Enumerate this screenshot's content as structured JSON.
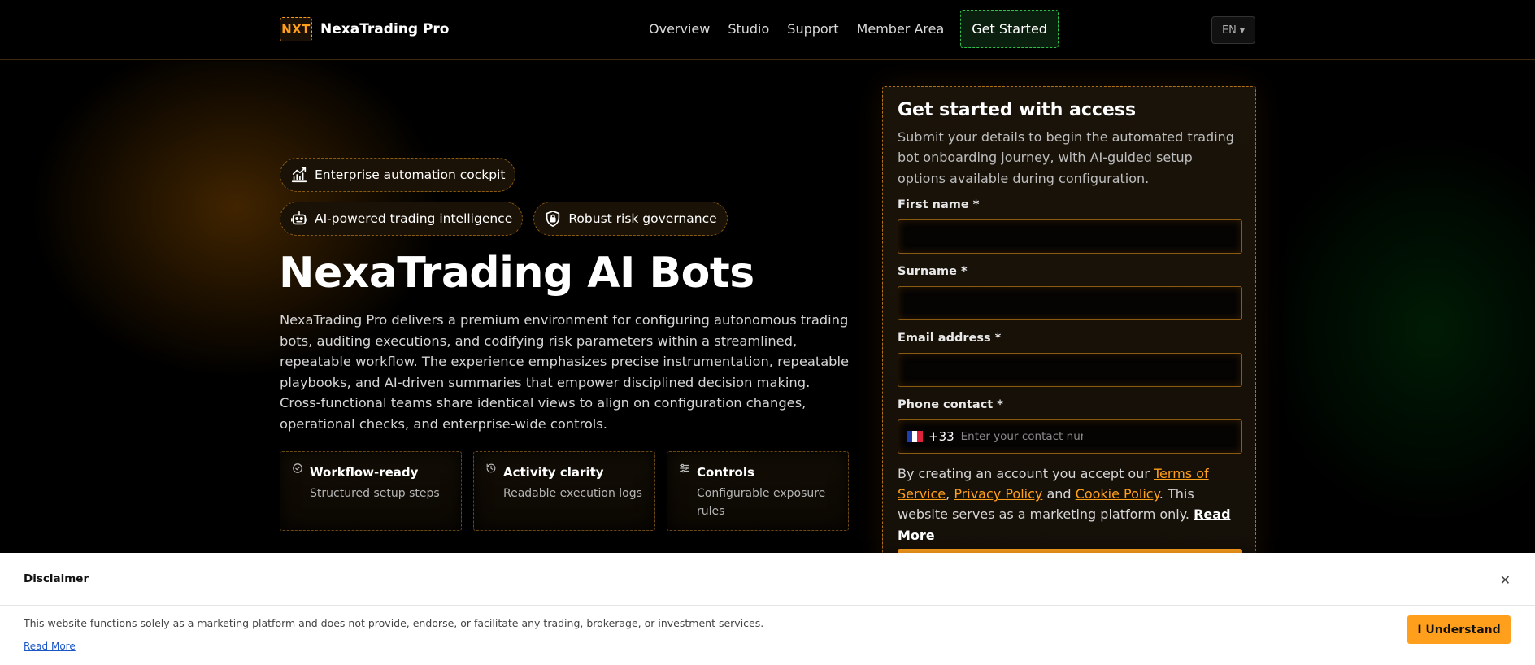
{
  "brand": {
    "mark": "NXT",
    "name": "NexaTrading Pro"
  },
  "nav": {
    "links": [
      "Overview",
      "Studio",
      "Support",
      "Member Area"
    ],
    "cta": "Get Started",
    "language": "EN"
  },
  "hero": {
    "badges": [
      {
        "label": "Enterprise automation cockpit",
        "icon": "chart-line-icon"
      },
      {
        "label": "AI-powered trading intelligence",
        "icon": "robot-icon"
      },
      {
        "label": "Robust risk governance",
        "icon": "shield-lock-icon"
      }
    ],
    "title": "NexaTrading AI Bots",
    "description": "NexaTrading Pro delivers a premium environment for configuring autonomous trading bots, auditing executions, and codifying risk parameters within a streamlined, repeatable workflow. The experience emphasizes precise instrumentation, repeatable playbooks, and AI-driven summaries that empower disciplined decision making. Cross-functional teams share identical views to align on configuration changes, operational checks, and enterprise-wide controls.",
    "features": [
      {
        "title": "Workflow-ready",
        "subtitle": "Structured setup steps",
        "icon": "check-circle-icon"
      },
      {
        "title": "Activity clarity",
        "subtitle": "Readable execution logs",
        "icon": "history-icon"
      },
      {
        "title": "Controls",
        "subtitle": "Configurable exposure rules",
        "icon": "sliders-icon"
      }
    ]
  },
  "signup": {
    "title": "Get started with access",
    "description": "Submit your details to begin the automated trading bot onboarding journey, with AI-guided setup options available during configuration.",
    "first_name_label": "First name *",
    "surname_label": "Surname *",
    "email_label": "Email address *",
    "phone_label": "Phone contact *",
    "phone_dial_code": "+33",
    "phone_placeholder": "Enter your contact number",
    "legal_prefix": "By creating an account you accept our ",
    "terms_link": "Terms of Service",
    "comma": ", ",
    "privacy_link": "Privacy Policy",
    "and_text": " and ",
    "cookie_link": "Cookie Policy",
    "legal_suffix": ". This website serves as a marketing platform only. ",
    "read_more": "Read More"
  },
  "disclaimer": {
    "title": "Disclaimer",
    "text": "This website functions solely as a marketing platform and does not provide, endorse, or facilitate any trading, brokerage, or investment services.",
    "read_more": "Read More",
    "button": "I Understand",
    "close_icon": "close-icon"
  },
  "colors": {
    "accent": "#ff9f1c",
    "cta_border": "#2fbf4a",
    "background": "#000000",
    "flag_blue": "#1f3ea8",
    "flag_white": "#ffffff",
    "flag_red": "#e0233a"
  }
}
